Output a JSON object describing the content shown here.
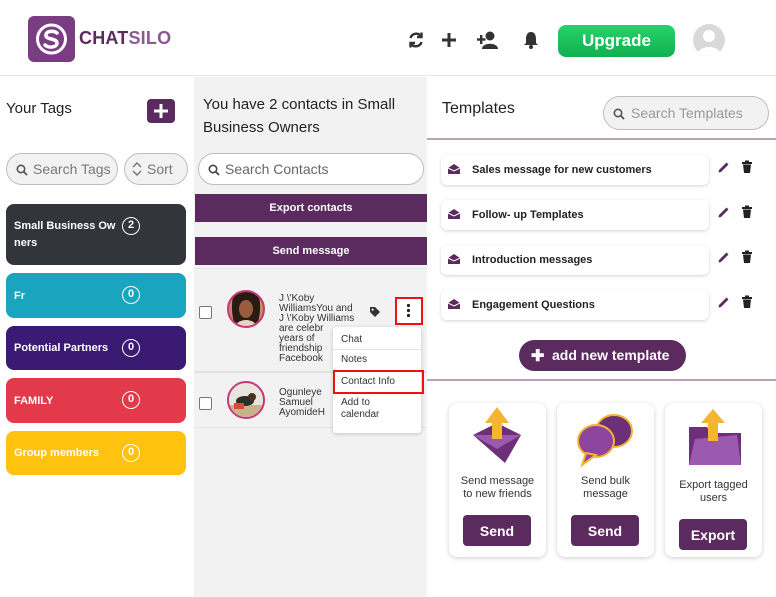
{
  "header": {
    "logo_chat": "CHAT",
    "logo_silo": "SILO",
    "upgrade_label": "Upgrade"
  },
  "tags": {
    "title": "Your Tags",
    "search_placeholder": "Search Tags",
    "sort_label": "Sort",
    "items": [
      {
        "line1": "Small Business Ow",
        "line2": "ners",
        "count": "2",
        "color": "#32363b"
      },
      {
        "line1": "Fr",
        "line2": "",
        "count": "0",
        "color": "#1aa5bf"
      },
      {
        "line1": "Potential Partners",
        "line2": "",
        "count": "0",
        "color": "#3b1a73"
      },
      {
        "line1": "FAMILY",
        "line2": "",
        "count": "0",
        "color": "#e23a4a"
      },
      {
        "line1": "Group members",
        "line2": "",
        "count": "0",
        "color": "#ffc20e"
      }
    ]
  },
  "contacts": {
    "title": "You have 2 contacts in Small Business Owners",
    "search_placeholder": "Search Contacts",
    "export_label": "Export contacts",
    "send_label": "Send message",
    "rows": [
      {
        "lines": [
          "J \\'Koby",
          "WilliamsYou and",
          "J \\'Koby Williams",
          "are celebr",
          "years of",
          "friendship",
          "Facebook"
        ]
      },
      {
        "lines": [
          "Ogunleye",
          "Samuel",
          "AyomideH"
        ]
      }
    ],
    "menu": {
      "chat": "Chat",
      "notes": "Notes",
      "contact_info": "Contact Info",
      "add_to_calendar_1": "Add to",
      "add_to_calendar_2": "calendar"
    }
  },
  "templates": {
    "title": "Templates",
    "search_placeholder": "Search Templates",
    "items": [
      {
        "label": "Sales message for new customers"
      },
      {
        "label": "Follow- up Templates"
      },
      {
        "label": "Introduction messages"
      },
      {
        "label": "Engagement Questions"
      }
    ],
    "add_label": "add new template",
    "actions": [
      {
        "desc1": "Send message",
        "desc2": "to new friends",
        "button": "Send"
      },
      {
        "desc1": "Send bulk",
        "desc2": "message",
        "button": "Send"
      },
      {
        "desc1": "Export tagged",
        "desc2": "users",
        "button": "Export"
      }
    ]
  },
  "colors": {
    "brand_purple": "#5b2a5e",
    "upgrade_green": "#1fc15d",
    "highlight_red": "#e11111"
  }
}
